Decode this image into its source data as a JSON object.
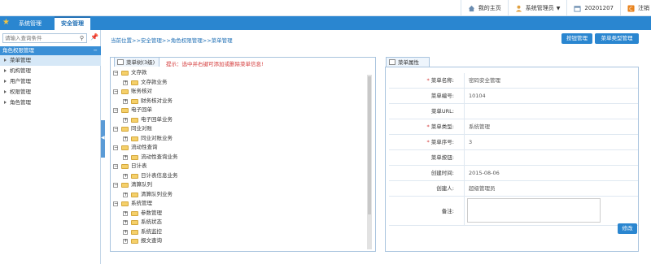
{
  "topbar": {
    "home": "我的主页",
    "user": "系统管理员",
    "date": "20201207",
    "logout": "注销"
  },
  "nav": {
    "tabs": [
      "系统管理",
      "安全管理"
    ]
  },
  "sidebar": {
    "search_placeholder": "请输入查询条件",
    "header": "角色权限管理",
    "items": [
      "菜单管理",
      "机构管理",
      "用户管理",
      "权限管理",
      "角色管理"
    ]
  },
  "breadcrumb": "当前位置>>安全管理>>角色权限管理>>菜单管理",
  "buttons": {
    "perm": "按钮管理",
    "menu_type": "菜单类型管理",
    "edit": "修改"
  },
  "tree_panel": {
    "tab": "菜单树(3级)",
    "hint": "提示：选中并右键可添加或删除菜单信息!",
    "nodes": [
      {
        "label": "文存款",
        "level": 0
      },
      {
        "label": "文存款业务",
        "level": 1
      },
      {
        "label": "账务核对",
        "level": 0
      },
      {
        "label": "财务核对业务",
        "level": 1
      },
      {
        "label": "电子回单",
        "level": 0
      },
      {
        "label": "电子回单业务",
        "level": 1
      },
      {
        "label": "同业对账",
        "level": 0
      },
      {
        "label": "同业对账业务",
        "level": 1
      },
      {
        "label": "流动性查询",
        "level": 0
      },
      {
        "label": "流动性查询业务",
        "level": 1
      },
      {
        "label": "日计表",
        "level": 0
      },
      {
        "label": "日计表信息业务",
        "level": 1
      },
      {
        "label": "清算队列",
        "level": 0
      },
      {
        "label": "清算队列业务",
        "level": 1
      },
      {
        "label": "系统管理",
        "level": 0
      },
      {
        "label": "参数管理",
        "level": 1
      },
      {
        "label": "系统状态",
        "level": 1
      },
      {
        "label": "系统监控",
        "level": 1
      },
      {
        "label": "报文查询",
        "level": 1
      }
    ]
  },
  "attr_panel": {
    "tab": "菜单属性",
    "fields": [
      {
        "label": "菜单名称:",
        "value": "密码安全管理",
        "required": true
      },
      {
        "label": "菜单编号:",
        "value": "10104",
        "required": false
      },
      {
        "label": "菜单URL:",
        "value": "",
        "required": false
      },
      {
        "label": "菜单类型:",
        "value": "系统管理",
        "required": true
      },
      {
        "label": "菜单序号:",
        "value": "3",
        "required": true
      },
      {
        "label": "菜单按钮:",
        "value": "",
        "required": false
      },
      {
        "label": "创建时间:",
        "value": "2015-08-06",
        "required": false
      },
      {
        "label": "创建人:",
        "value": "超级管理员",
        "required": false
      },
      {
        "label": "备注:",
        "value": "",
        "required": false
      }
    ]
  },
  "colors": {
    "nav": "#2a86d0",
    "sidebar_header": "#3a8fd6",
    "hint": "#d43a3a",
    "link": "#1f6fb5"
  }
}
